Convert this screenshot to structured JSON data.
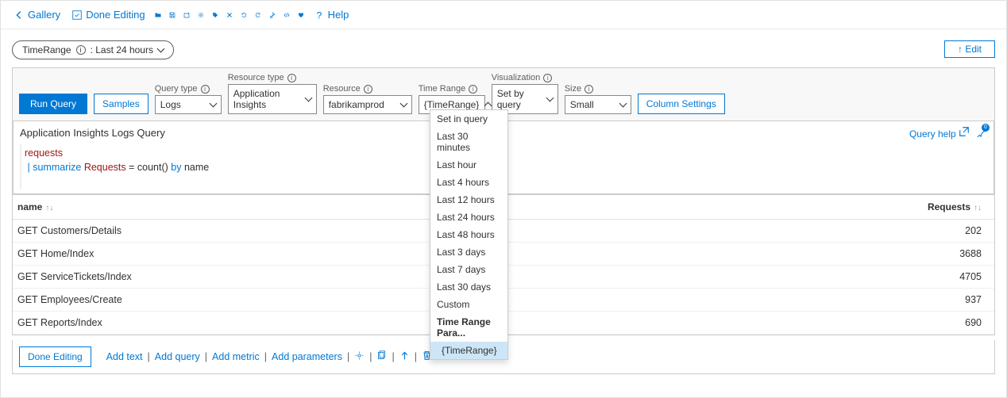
{
  "toolbar": {
    "gallery": "Gallery",
    "done_editing": "Done Editing",
    "help": "Help"
  },
  "pill": {
    "label": "TimeRange",
    "value": ": Last 24 hours"
  },
  "edit_btn": "↑ Edit",
  "controls": {
    "run_query": "Run Query",
    "samples": "Samples",
    "query_type": {
      "label": "Query type",
      "value": "Logs"
    },
    "resource_type": {
      "label": "Resource type",
      "value": "Application Insights"
    },
    "resource": {
      "label": "Resource",
      "value": "fabrikamprod"
    },
    "time_range": {
      "label": "Time Range",
      "value": "{TimeRange}"
    },
    "visualization": {
      "label": "Visualization",
      "value": "Set by query"
    },
    "size": {
      "label": "Size",
      "value": "Small"
    },
    "column_settings": "Column Settings"
  },
  "dropdown": {
    "items": [
      "Set in query",
      "Last 30 minutes",
      "Last hour",
      "Last 4 hours",
      "Last 12 hours",
      "Last 24 hours",
      "Last 48 hours",
      "Last 3 days",
      "Last 7 days",
      "Last 30 days",
      "Custom"
    ],
    "group_header": "Time Range Para...",
    "selected": "{TimeRange}"
  },
  "query": {
    "title": "Application Insights Logs Query",
    "help": "Query help",
    "line1_table": "requests",
    "line2_pipe": "|",
    "line2_kw1": "summarize",
    "line2_col": "Requests",
    "line2_eq": " = ",
    "line2_fn": "count()",
    "line2_kw2": "by",
    "line2_name": " name"
  },
  "table": {
    "col1": "name",
    "col2": "Requests",
    "rows": [
      {
        "name": "GET Customers/Details",
        "requests": "202"
      },
      {
        "name": "GET Home/Index",
        "requests": "3688"
      },
      {
        "name": "GET ServiceTickets/Index",
        "requests": "4705"
      },
      {
        "name": "GET Employees/Create",
        "requests": "937"
      },
      {
        "name": "GET Reports/Index",
        "requests": "690"
      }
    ]
  },
  "footer": {
    "done_editing": "Done Editing",
    "add_text": "Add text",
    "add_query": "Add query",
    "add_metric": "Add metric",
    "add_parameters": "Add parameters"
  }
}
